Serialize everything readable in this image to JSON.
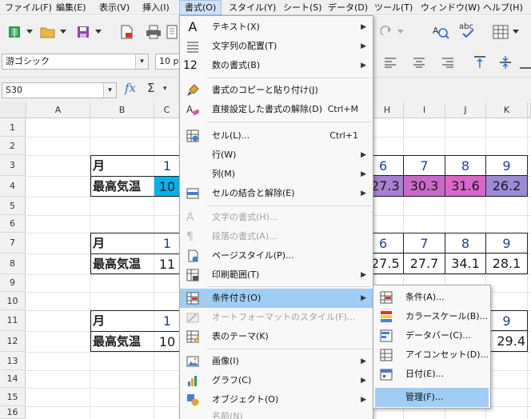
{
  "menubar": [
    "ファイル(F)",
    "編集(E)",
    "表示(V)",
    "挿入(I)",
    "書式(O)",
    "スタイル(Y)",
    "シート(S)",
    "データ(D)",
    "ツール(T)",
    "ウィンドウ(W)",
    "ヘルプ(H)"
  ],
  "font_name": "游ゴシック",
  "font_size": "10 pt",
  "name_box": "S30",
  "columns": [
    "A",
    "B",
    "C",
    "H",
    "I",
    "J",
    "K"
  ],
  "rows": [
    "1",
    "2",
    "3",
    "4",
    "5",
    "6",
    "7",
    "8",
    "9",
    "10",
    "11",
    "12",
    "13",
    "14",
    "15",
    "16"
  ],
  "table1": {
    "label_month": "月",
    "label_temp": "最高気温",
    "c_month": "1",
    "c_temp": "10",
    "months": [
      "6",
      "7",
      "8",
      "9"
    ],
    "temps": [
      "27.3",
      "30.3",
      "31.6",
      "26.2"
    ]
  },
  "table2": {
    "label_month": "月",
    "label_temp": "最高気温",
    "c_month": "1",
    "c_temp": "11",
    "months": [
      "6",
      "7",
      "8",
      "9"
    ],
    "temps": [
      "27.5",
      "27.7",
      "34.1",
      "28.1"
    ]
  },
  "table3": {
    "label_month": "月",
    "label_temp": "最高気温",
    "c_month": "1",
    "c_temp": "10",
    "k_month": "9",
    "k_temp": "29.4"
  },
  "format_menu": [
    {
      "label": "テキスト(X)",
      "sub": true
    },
    {
      "label": "文字列の配置(T)",
      "sub": true
    },
    {
      "label": "数の書式(B)",
      "sub": true
    },
    {
      "label": "書式のコピーと貼り付け(J)"
    },
    {
      "label": "直接設定した書式の解除(D)",
      "shortcut": "Ctrl+M"
    },
    {
      "label": "セル(L)...",
      "shortcut": "Ctrl+1"
    },
    {
      "label": "行(W)",
      "sub": true
    },
    {
      "label": "列(M)",
      "sub": true
    },
    {
      "label": "セルの結合と解除(E)",
      "sub": true
    },
    {
      "label": "文字の書式(H)...",
      "disabled": true
    },
    {
      "label": "段落の書式(A)...",
      "disabled": true
    },
    {
      "label": "ページスタイル(P)..."
    },
    {
      "label": "印刷範囲(T)",
      "sub": true
    },
    {
      "label": "条件付き(O)",
      "sub": true,
      "highlighted": true
    },
    {
      "label": "オートフォーマットのスタイル(F)...",
      "disabled": true
    },
    {
      "label": "表のテーマ(K)"
    },
    {
      "label": "画像(I)",
      "sub": true
    },
    {
      "label": "グラフ(C)",
      "sub": true
    },
    {
      "label": "オブジェクト(O)",
      "sub": true
    },
    {
      "label": "名前(N)",
      "disabled": true
    }
  ],
  "conditional_submenu": [
    "条件(A)...",
    "カラースケール(B)...",
    "データバー(C)...",
    "アイコンセット(D)...",
    "日付(E)...",
    "管理(F)..."
  ],
  "colors": {
    "accent": "#9fcdf4",
    "cyan": "#00b0f0",
    "magenta": "#d966c8",
    "purple": "#9b8bd4"
  }
}
